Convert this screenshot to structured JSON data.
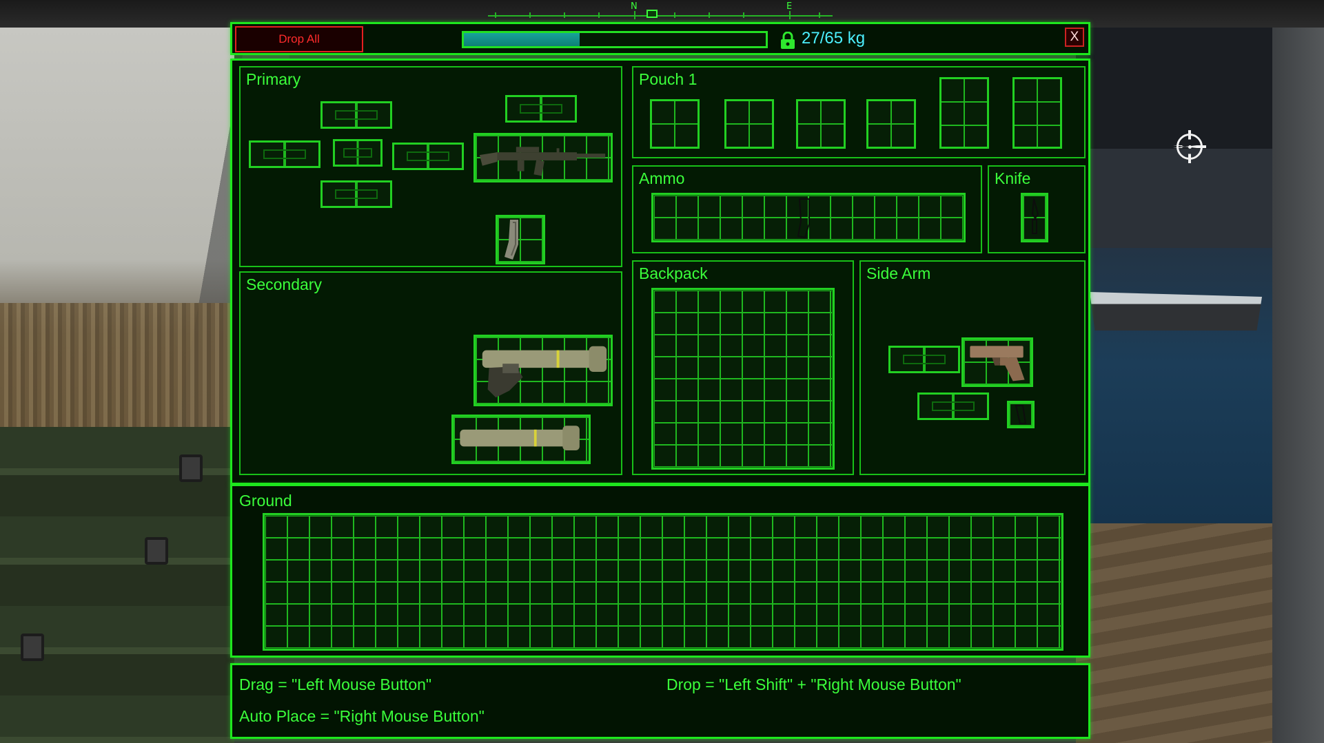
{
  "compass": {
    "north": "N",
    "east": "E"
  },
  "toolbar": {
    "drop_all_label": "Drop All",
    "weight_text": "27/65 kg",
    "weight_fraction": 0.27,
    "close_label": "X"
  },
  "sections": {
    "primary": "Primary",
    "secondary": "Secondary",
    "pouch": "Pouch 1",
    "ammo": "Ammo",
    "knife": "Knife",
    "backpack": "Backpack",
    "sidearm": "Side Arm",
    "ground": "Ground"
  },
  "help": {
    "drag": "Drag = \"Left Mouse Button\"",
    "drop": "Drop = \"Left Shift\" + \"Right Mouse Button\"",
    "auto_place": "Auto Place = \"Right Mouse Button\""
  },
  "colors": {
    "ui_green": "#1ee81e",
    "panel_bg": "#021402",
    "drop_red": "#e52020",
    "weight_cyan": "#4cf0ff",
    "weight_fill": "#17a39a"
  },
  "icons": [
    "rifle-icon",
    "magazine-icon",
    "launcher-icon",
    "knife-icon",
    "pistol-icon",
    "lock-icon",
    "crosshair-icon"
  ]
}
